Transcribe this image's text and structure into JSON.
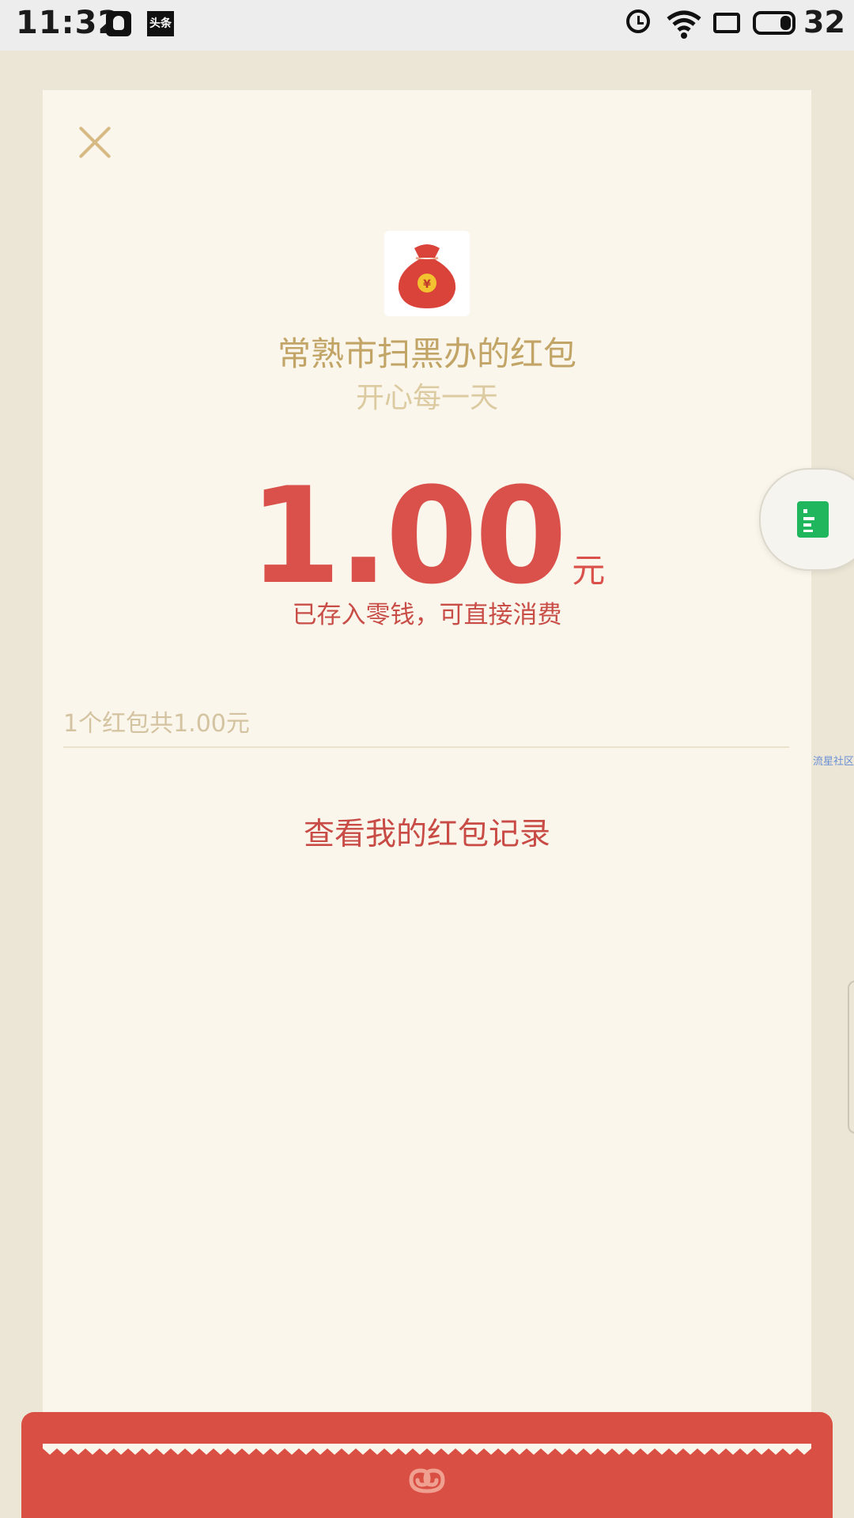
{
  "status_bar": {
    "time": "11:32",
    "notification_icons": [
      "qq-icon",
      "toutiao-icon"
    ],
    "toutiao_label": "头条",
    "system_icons": [
      "alarm-icon",
      "wifi-icon",
      "sim-icon",
      "battery-icon"
    ],
    "battery_level": "32",
    "battery_fraction": 0.32
  },
  "red_packet": {
    "close_icon": "close-icon",
    "sender_avatar_icon": "money-bag-icon",
    "money_bag_symbol": "¥",
    "sender_name": "常熟市扫黑办的红包",
    "blessing": "开心每一天",
    "amount": "1.00",
    "unit": "元",
    "deposit_note": "已存入零钱，可直接消费",
    "summary": "1个红包共1.00元",
    "records_link": "查看我的红包记录"
  },
  "overlay": {
    "floating_button_icon": "document-icon",
    "watermark": "流星社区"
  },
  "colors": {
    "background": "#ece6d6",
    "card": "#faf6ec",
    "accent_red": "#d9514a",
    "gold_text": "#c2a466",
    "bottom_red": "#d94f43",
    "floating_icon_green": "#1fb65e"
  }
}
